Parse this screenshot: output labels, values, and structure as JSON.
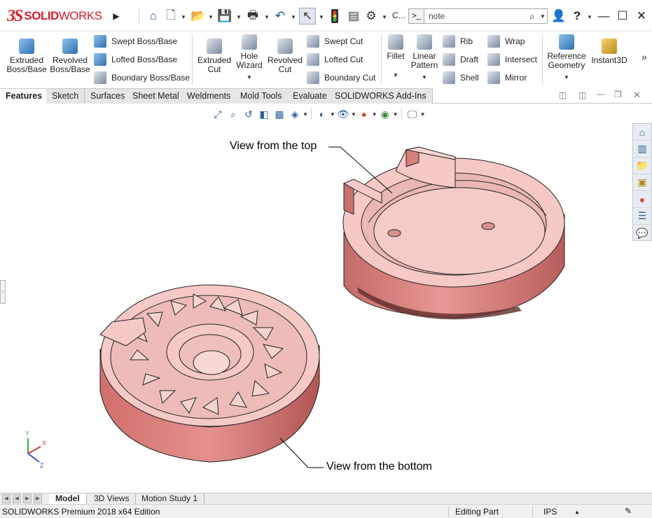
{
  "app": {
    "logo_prefix": "3S",
    "logo_solid": "SOLID",
    "logo_works": "WORKS"
  },
  "quick_access": {
    "search_value": "note",
    "truncated_label": "C..."
  },
  "command_manager": {
    "extruded_boss": "Extruded\nBoss/Base",
    "revolved_boss": "Revolved\nBoss/Base",
    "swept_boss": "Swept Boss/Base",
    "lofted_boss": "Lofted Boss/Base",
    "boundary_boss": "Boundary Boss/Base",
    "extruded_cut": "Extruded\nCut",
    "hole_wizard": "Hole\nWizard",
    "revolved_cut": "Revolved\nCut",
    "swept_cut": "Swept Cut",
    "lofted_cut": "Lofted Cut",
    "boundary_cut": "Boundary Cut",
    "fillet": "Fillet",
    "linear_pattern": "Linear\nPattern",
    "rib": "Rib",
    "draft": "Draft",
    "shell": "Shell",
    "wrap": "Wrap",
    "intersect": "Intersect",
    "mirror": "Mirror",
    "reference_geometry": "Reference\nGeometry",
    "instant3d": "Instant3D"
  },
  "tabs": [
    "Features",
    "Sketch",
    "Surfaces",
    "Sheet Metal",
    "Weldments",
    "Mold Tools",
    "Evaluate",
    "SOLIDWORKS Add-Ins"
  ],
  "graphics": {
    "label_top": "View from the top",
    "label_bottom": "View from the bottom",
    "triad_x": "X",
    "triad_y": "Y",
    "triad_z": "Z"
  },
  "bottom_tabs": [
    "Model",
    "3D Views",
    "Motion Study 1"
  ],
  "status": {
    "edition": "SOLIDWORKS Premium 2018 x64 Edition",
    "mode": "Editing Part",
    "units": "IPS"
  },
  "colors": {
    "part_face": "#f6c9c6",
    "part_side": "#d87f7c",
    "part_dark": "#a84c4b",
    "brand": "#d81e2c"
  }
}
